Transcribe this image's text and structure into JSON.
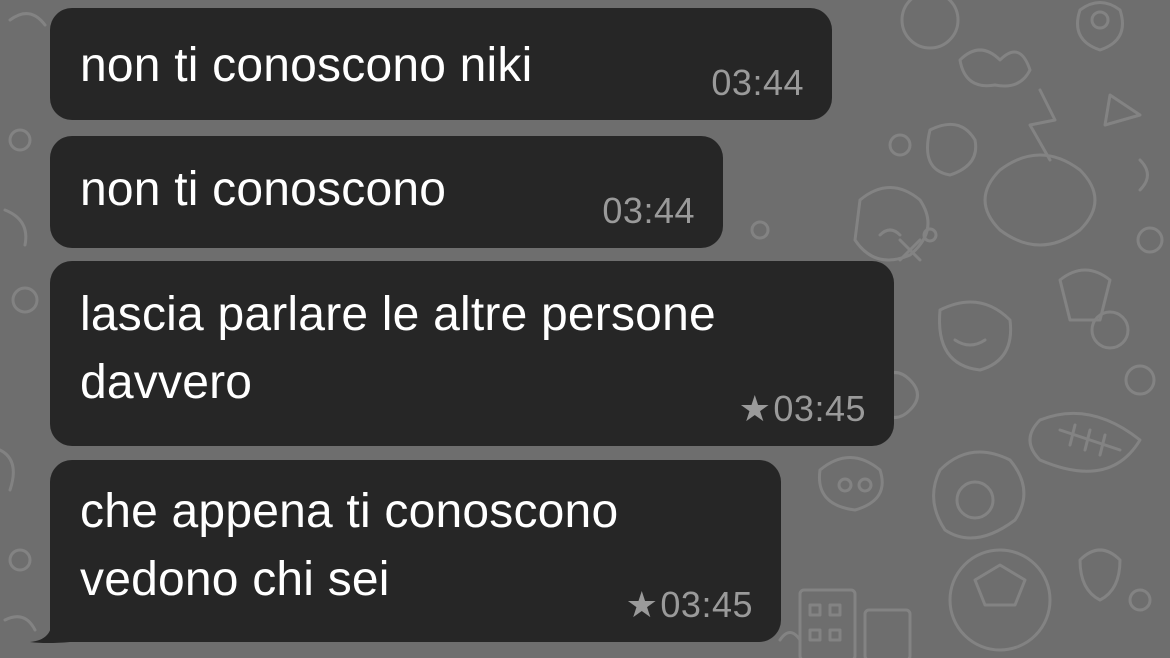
{
  "chat": {
    "messages": [
      {
        "text": "non ti conoscono niki",
        "time": "03:44",
        "starred": false
      },
      {
        "text": "non ti conoscono",
        "time": "03:44",
        "starred": false
      },
      {
        "text": "lascia parlare le altre persone\ndavvero",
        "time": "03:45",
        "starred": true,
        "star_icon": "★"
      },
      {
        "text": "che appena ti conoscono\nvedono chi sei",
        "time": "03:45",
        "starred": true,
        "star_icon": "★"
      }
    ]
  },
  "colors": {
    "bubble": "#262626",
    "background": "#6e6e6e",
    "timestamp": "#9a9a9a",
    "text": "#ffffff"
  }
}
